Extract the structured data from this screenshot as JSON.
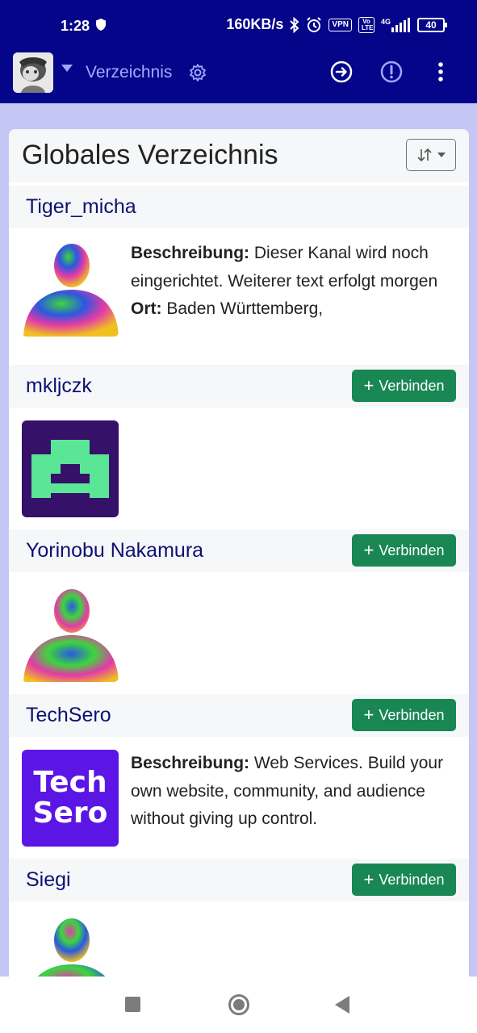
{
  "status_bar": {
    "time": "1:28",
    "speed": "160KB/s",
    "vpn": "VPN",
    "volte": "Vo LTE",
    "network": "4G",
    "battery": "40"
  },
  "app_bar": {
    "title": "Verzeichnis"
  },
  "directory": {
    "title": "Globales Verzeichnis",
    "connect_label": "Verbinden",
    "desc_label": "Beschreibung:",
    "location_label": "Ort:",
    "entries": [
      {
        "name": "Tiger_micha",
        "description": "Dieser Kanal wird noch eingerichtet. Weiterer text erfolgt morgen",
        "location": "Baden Württemberg,"
      },
      {
        "name": "mkljczk"
      },
      {
        "name": "Yorinobu Nakamura"
      },
      {
        "name": "TechSero",
        "description": "Web Services. Build your own website, community, and audience without giving up control.",
        "logo_line1": "Tech",
        "logo_line2": "Sero"
      },
      {
        "name": "Siegi"
      }
    ]
  },
  "colors": {
    "bar": "#05058a",
    "accent": "#198754",
    "name": "#0c1272",
    "background": "#c4c6f6"
  }
}
